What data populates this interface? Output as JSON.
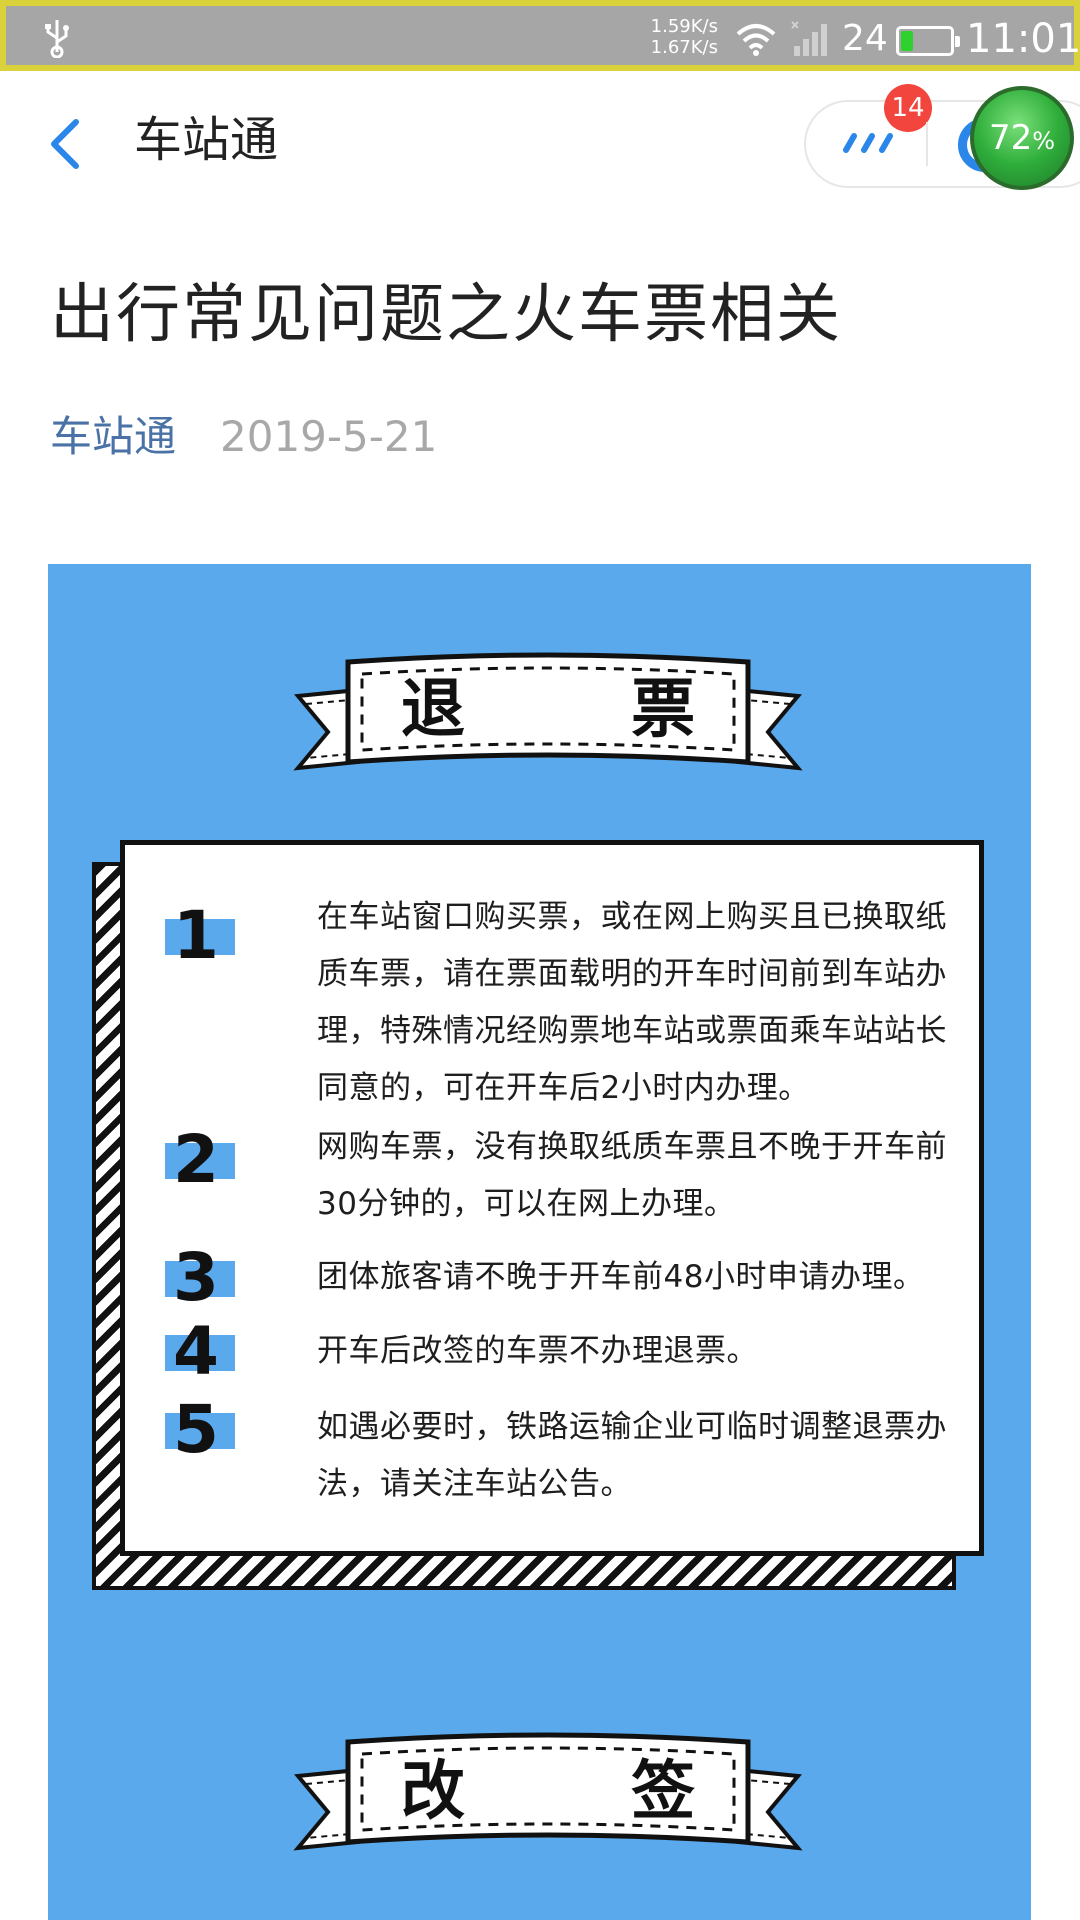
{
  "status_bar": {
    "speed_up": "1.59K/s",
    "speed_down": "1.67K/s",
    "battery_level": "24",
    "time": "11:01",
    "icons": [
      "usb-icon",
      "wifi-icon",
      "signal-icon",
      "battery-icon"
    ]
  },
  "header": {
    "title": "车站通",
    "notification_count": "14",
    "progress_percent": "72",
    "progress_unit": "%"
  },
  "article": {
    "title": "出行常见问题之火车票相关",
    "source": "车站通",
    "date": "2019-5-21"
  },
  "infographic": {
    "section1_title": "退 票",
    "section2_title": "改 签",
    "items": [
      {
        "num": "1",
        "text": "在车站窗口购买票，或在网上购买且已换取纸质车票，请在票面载明的开车时间前到车站办理，特殊情况经购票地车站或票面乘车站站长同意的，可在开车后2小时内办理。"
      },
      {
        "num": "2",
        "text": "网购车票，没有换取纸质车票且不晚于开车前30分钟的，可以在网上办理。"
      },
      {
        "num": "3",
        "text": "团体旅客请不晚于开车前48小时申请办理。"
      },
      {
        "num": "4",
        "text": "开车后改签的车票不办理退票。"
      },
      {
        "num": "5",
        "text": "如遇必要时，铁路运输企业可临时调整退票办法，请关注车站公告。"
      }
    ],
    "colors": {
      "background": "#5aa9ec",
      "card": "#ffffff",
      "ink": "#111111"
    }
  }
}
